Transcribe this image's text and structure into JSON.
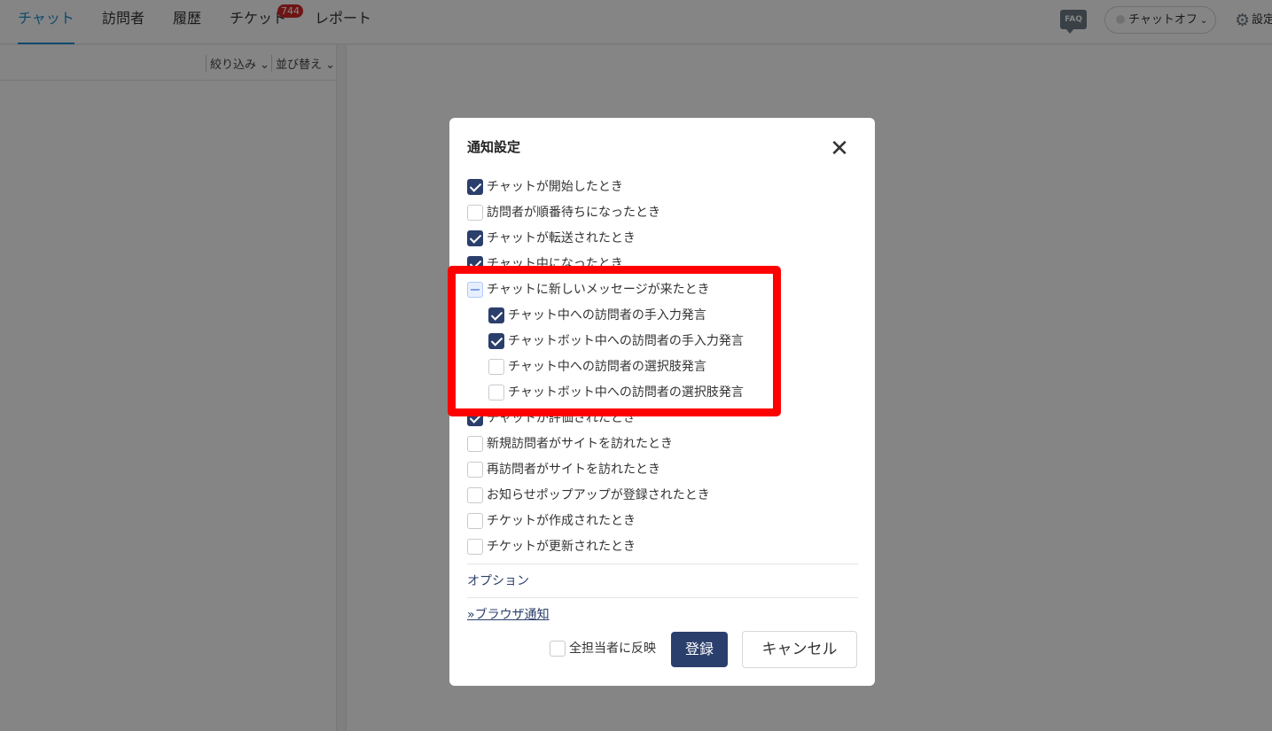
{
  "nav": {
    "tabs": [
      {
        "label": "チャット",
        "active": true
      },
      {
        "label": "訪問者"
      },
      {
        "label": "履歴"
      },
      {
        "label": "チケット",
        "badge": "744"
      },
      {
        "label": "レポート"
      }
    ],
    "faq_label": "FAQ",
    "chat_status": "チャットオフ",
    "settings_label": "設定"
  },
  "sidebar": {
    "filter_label": "絞り込み",
    "sort_label": "並び替え"
  },
  "modal": {
    "title": "通知設定",
    "items": [
      {
        "label": "チャットが開始したとき",
        "state": "checked"
      },
      {
        "label": "訪問者が順番待ちになったとき",
        "state": "unchecked"
      },
      {
        "label": "チャットが転送されたとき",
        "state": "checked"
      },
      {
        "label": "チャット中になったとき",
        "state": "checked"
      },
      {
        "label": "チャットに新しいメッセージが来たとき",
        "state": "indeterminate"
      },
      {
        "label": "チャット中への訪問者の手入力発言",
        "state": "checked",
        "sub": true
      },
      {
        "label": "チャットボット中への訪問者の手入力発言",
        "state": "checked",
        "sub": true
      },
      {
        "label": "チャット中への訪問者の選択肢発言",
        "state": "unchecked",
        "sub": true
      },
      {
        "label": "チャットボット中への訪問者の選択肢発言",
        "state": "unchecked",
        "sub": true
      },
      {
        "label": "チャットが評価されたとき",
        "state": "checked"
      },
      {
        "label": "新規訪問者がサイトを訪れたとき",
        "state": "unchecked"
      },
      {
        "label": "再訪問者がサイトを訪れたとき",
        "state": "unchecked"
      },
      {
        "label": "お知らせポップアップが登録されたとき",
        "state": "unchecked"
      },
      {
        "label": "チケットが作成されたとき",
        "state": "unchecked"
      },
      {
        "label": "チケットが更新されたとき",
        "state": "unchecked"
      }
    ],
    "options_label": "オプション",
    "browser_link": "»ブラウザ通知",
    "apply_all_label": "全担当者に反映",
    "register_label": "登録",
    "cancel_label": "キャンセル"
  },
  "colors": {
    "accent": "#1d8fd0",
    "primary": "#2b3f6c",
    "badge": "#d42a2a",
    "highlight": "#ff0000"
  }
}
